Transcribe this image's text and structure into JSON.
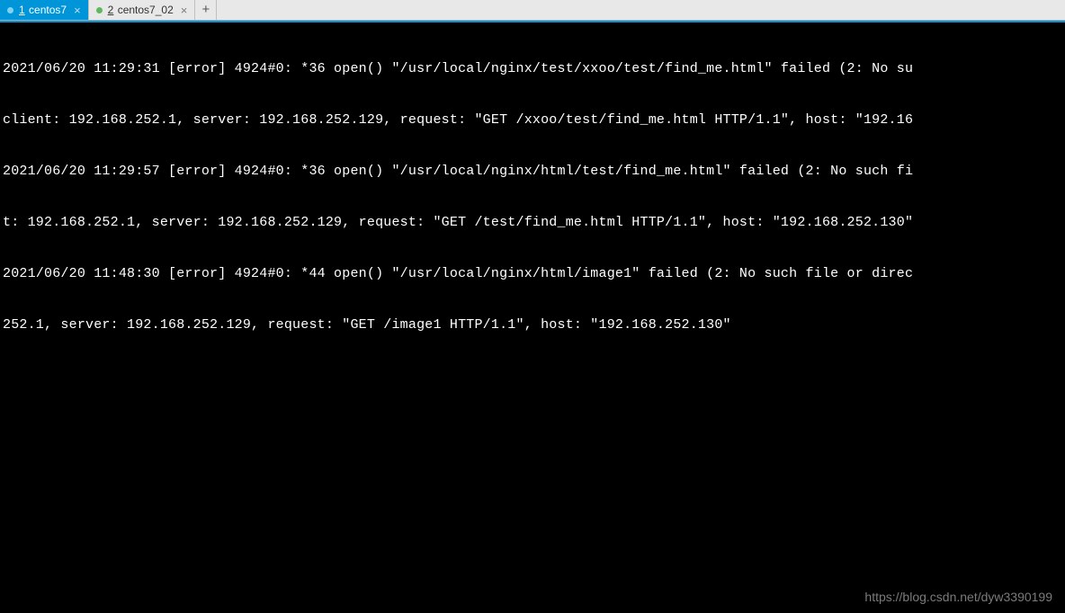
{
  "tabs": [
    {
      "num": "1",
      "label": "centos7",
      "active": true,
      "dotClass": ""
    },
    {
      "num": "2",
      "label": "centos7_02",
      "active": false,
      "dotClass": "green"
    }
  ],
  "addTabSymbol": "+",
  "closeSymbol": "×",
  "terminal": {
    "lines": [
      "2021/06/20 11:29:31 [error] 4924#0: *36 open() \"/usr/local/nginx/test/xxoo/test/find_me.html\" failed (2: No su",
      "client: 192.168.252.1, server: 192.168.252.129, request: \"GET /xxoo/test/find_me.html HTTP/1.1\", host: \"192.16",
      "2021/06/20 11:29:57 [error] 4924#0: *36 open() \"/usr/local/nginx/html/test/find_me.html\" failed (2: No such fi",
      "t: 192.168.252.1, server: 192.168.252.129, request: \"GET /test/find_me.html HTTP/1.1\", host: \"192.168.252.130\"",
      "2021/06/20 11:48:30 [error] 4924#0: *44 open() \"/usr/local/nginx/html/image1\" failed (2: No such file or direc",
      "252.1, server: 192.168.252.129, request: \"GET /image1 HTTP/1.1\", host: \"192.168.252.130\""
    ]
  },
  "watermark": "https://blog.csdn.net/dyw3390199"
}
